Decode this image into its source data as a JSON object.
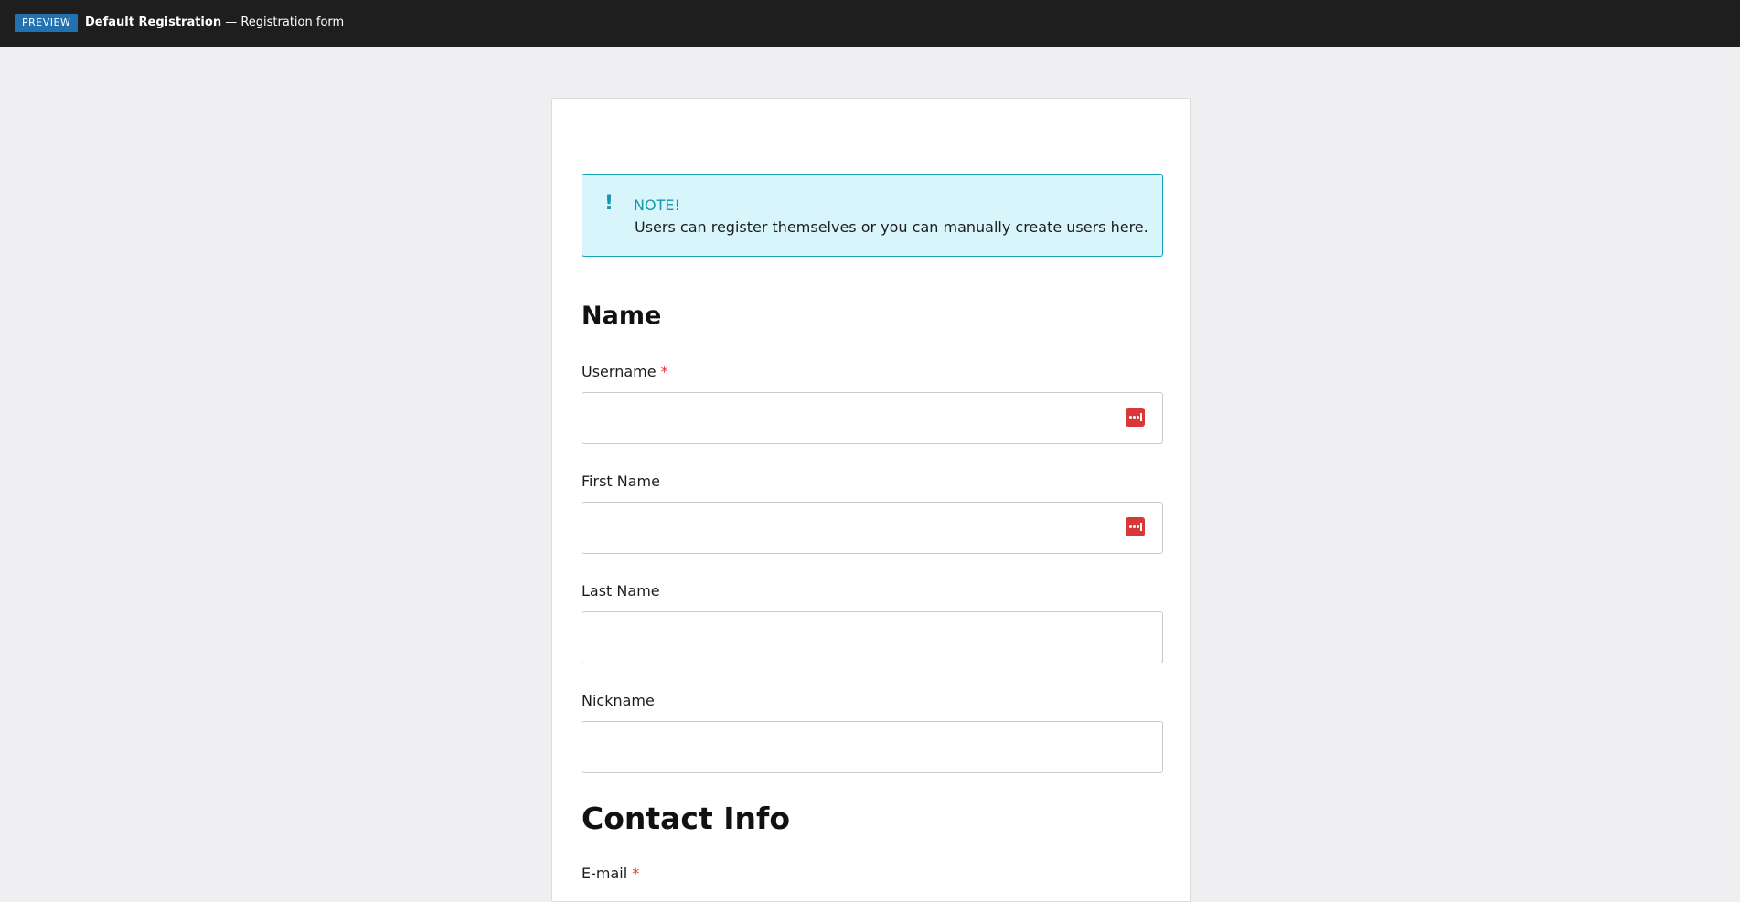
{
  "topbar": {
    "badge": "PREVIEW",
    "title_bold": "Default Registration",
    "title_rest": " — Registration form"
  },
  "notice": {
    "icon": "exclamation-icon",
    "title": "NOTE!",
    "text": "Users can register themselves or you can manually create users here."
  },
  "sections": {
    "name": "Name",
    "contact": "Contact Info"
  },
  "fields": {
    "username": {
      "label": "Username",
      "required_mark": "*",
      "value": ""
    },
    "first_name": {
      "label": "First Name",
      "value": ""
    },
    "last_name": {
      "label": "Last Name",
      "value": ""
    },
    "nickname": {
      "label": "Nickname",
      "value": ""
    },
    "email": {
      "label": "E-mail",
      "required_mark": "*"
    }
  },
  "colors": {
    "topbar": "#1e1e1e",
    "badge": "#2271b1",
    "notice_bg": "#d7f5fb",
    "notice_accent": "#14a3b8",
    "required": "#d63638",
    "autofill_icon": "#d93838"
  }
}
